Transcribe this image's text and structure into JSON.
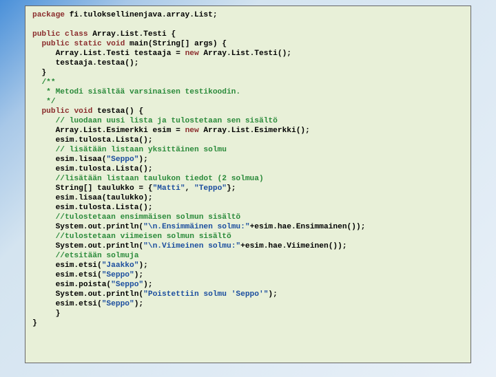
{
  "code": {
    "tokens": [
      {
        "t": "kw",
        "v": "package"
      },
      {
        "t": "txt",
        "v": " fi.tuloksellinenjava.array.List;\n\n"
      },
      {
        "t": "kw",
        "v": "public"
      },
      {
        "t": "txt",
        "v": " "
      },
      {
        "t": "kw",
        "v": "class"
      },
      {
        "t": "txt",
        "v": " Array.List.Testi {\n  "
      },
      {
        "t": "kw",
        "v": "public"
      },
      {
        "t": "txt",
        "v": " "
      },
      {
        "t": "kw",
        "v": "static"
      },
      {
        "t": "txt",
        "v": " "
      },
      {
        "t": "kw",
        "v": "void"
      },
      {
        "t": "txt",
        "v": " main(String[] args) {\n     Array.List.Testi testaaja = "
      },
      {
        "t": "kw",
        "v": "new"
      },
      {
        "t": "txt",
        "v": " Array.List.Testi();\n     testaaja.testaa();\n  }\n  "
      },
      {
        "t": "cmt",
        "v": "/**\n   * Metodi sisältää varsinaisen testikoodin.\n   */"
      },
      {
        "t": "txt",
        "v": "\n  "
      },
      {
        "t": "kw",
        "v": "public"
      },
      {
        "t": "txt",
        "v": " "
      },
      {
        "t": "kw",
        "v": "void"
      },
      {
        "t": "txt",
        "v": " testaa() {\n     "
      },
      {
        "t": "cmt",
        "v": "// luodaan uusi lista ja tulostetaan sen sisältö"
      },
      {
        "t": "txt",
        "v": "\n     Array.List.Esimerkki esim = "
      },
      {
        "t": "kw",
        "v": "new"
      },
      {
        "t": "txt",
        "v": " Array.List.Esimerkki();\n     esim.tulosta.Lista();\n     "
      },
      {
        "t": "cmt",
        "v": "// lisätään listaan yksittäinen solmu"
      },
      {
        "t": "txt",
        "v": "\n     esim.lisaa("
      },
      {
        "t": "str",
        "v": "\"Seppo\""
      },
      {
        "t": "txt",
        "v": ");\n     esim.tulosta.Lista();\n     "
      },
      {
        "t": "cmt",
        "v": "//lisätään listaan taulukon tiedot (2 solmua)"
      },
      {
        "t": "txt",
        "v": "\n     String[] taulukko = {"
      },
      {
        "t": "str",
        "v": "\"Matti\""
      },
      {
        "t": "txt",
        "v": ", "
      },
      {
        "t": "str",
        "v": "\"Teppo\""
      },
      {
        "t": "txt",
        "v": "};\n     esim.lisaa(taulukko);\n     esim.tulosta.Lista();\n     "
      },
      {
        "t": "cmt",
        "v": "//tulostetaan ensimmäisen solmun sisältö"
      },
      {
        "t": "txt",
        "v": "\n     System.out.println("
      },
      {
        "t": "str",
        "v": "\"\\n.Ensimmäinen solmu:\""
      },
      {
        "t": "txt",
        "v": "+esim.hae.Ensimmainen());\n     "
      },
      {
        "t": "cmt",
        "v": "//tulostetaan viimeisen solmun sisältö"
      },
      {
        "t": "txt",
        "v": "\n     System.out.println("
      },
      {
        "t": "str",
        "v": "\"\\n.Viimeinen solmu:\""
      },
      {
        "t": "txt",
        "v": "+esim.hae.Viimeinen());\n     "
      },
      {
        "t": "cmt",
        "v": "//etsitään solmuja"
      },
      {
        "t": "txt",
        "v": "\n     esim.etsi("
      },
      {
        "t": "str",
        "v": "\"Jaakko\""
      },
      {
        "t": "txt",
        "v": ");\n     esim.etsi("
      },
      {
        "t": "str",
        "v": "\"Seppo\""
      },
      {
        "t": "txt",
        "v": ");\n     esim.poista("
      },
      {
        "t": "str",
        "v": "\"Seppo\""
      },
      {
        "t": "txt",
        "v": ");\n     System.out.println("
      },
      {
        "t": "str",
        "v": "\"Poistettiin solmu 'Seppo'\""
      },
      {
        "t": "txt",
        "v": ");\n     esim.etsi("
      },
      {
        "t": "str",
        "v": "\"Seppo\""
      },
      {
        "t": "txt",
        "v": ");\n     }\n}"
      }
    ]
  }
}
